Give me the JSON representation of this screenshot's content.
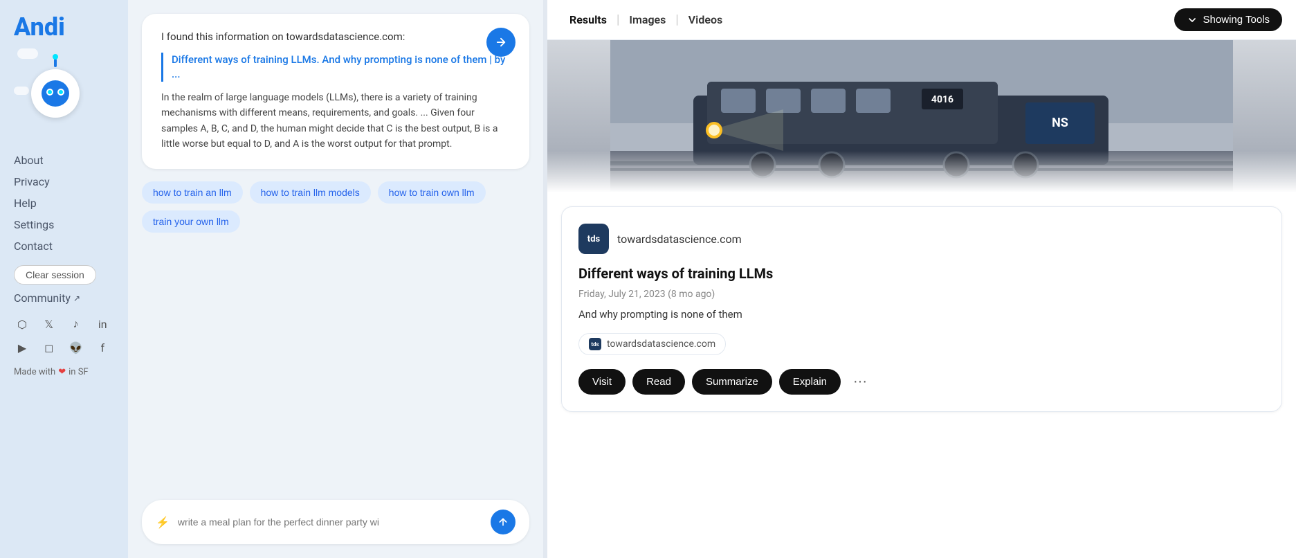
{
  "sidebar": {
    "logo": "Andi",
    "nav_items": [
      {
        "label": "About",
        "id": "about"
      },
      {
        "label": "Privacy",
        "id": "privacy"
      },
      {
        "label": "Help",
        "id": "help"
      },
      {
        "label": "Settings",
        "id": "settings"
      },
      {
        "label": "Contact",
        "id": "contact"
      }
    ],
    "clear_session": "Clear session",
    "community": "Community",
    "made_with": "Made with",
    "made_in": "in SF",
    "social": [
      "discord",
      "twitter",
      "tiktok",
      "linkedin",
      "youtube",
      "instagram",
      "reddit",
      "facebook"
    ]
  },
  "chat": {
    "bubble_header": "I found this information on towardsdatascience.com:",
    "link_text": "Different ways of training LLMs. And why prompting is none of them | by ...",
    "body_text": "In the realm of large language models (LLMs), there is a variety of training mechanisms with different means, requirements, and goals. ... Given four samples A, B, C, and D, the human might decide that C is the best output, B is a little worse but equal to D, and A is the worst output for that prompt.",
    "chips": [
      {
        "label": "how to train an llm",
        "id": "chip1"
      },
      {
        "label": "how to train llm models",
        "id": "chip2"
      },
      {
        "label": "how to train own llm",
        "id": "chip3"
      },
      {
        "label": "train your own llm",
        "id": "chip4"
      }
    ],
    "input_placeholder": "write a meal plan for the perfect dinner party wi"
  },
  "right_panel": {
    "tabs": [
      {
        "label": "Results",
        "active": true
      },
      {
        "label": "Images",
        "active": false
      },
      {
        "label": "Videos",
        "active": false
      }
    ],
    "showing_tools_btn": "Showing Tools",
    "result": {
      "source_abbr": "tds",
      "source_domain": "towardsdatascience.com",
      "title": "Different ways of training LLMs",
      "date": "Friday, July 21, 2023 (8 mo ago)",
      "description": "And why prompting is none of them",
      "pill_domain": "towardsdatascience.com",
      "actions": [
        "Visit",
        "Read",
        "Summarize",
        "Explain"
      ]
    }
  }
}
